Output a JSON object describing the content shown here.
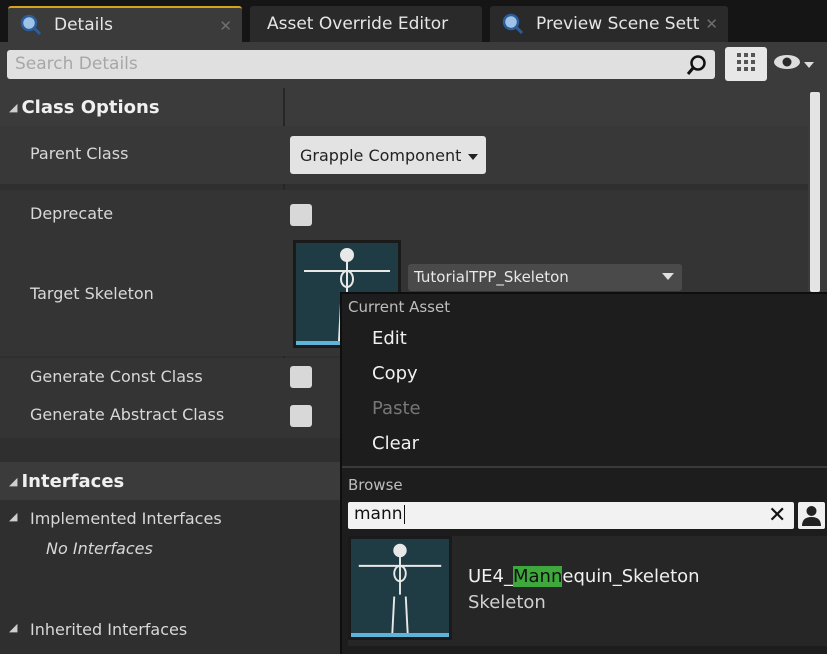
{
  "tabs": [
    {
      "label": "Details",
      "close": "✕",
      "icon": "search-icon"
    },
    {
      "label": "Asset Override Editor"
    },
    {
      "label": "Preview Scene Sett",
      "close": "✕",
      "icon": "search-icon"
    }
  ],
  "search": {
    "placeholder": "Search Details"
  },
  "class_options": {
    "header": "Class Options",
    "parent_class_label": "Parent Class",
    "parent_class_value": "Grapple Component",
    "deprecate_label": "Deprecate",
    "target_skeleton_label": "Target Skeleton",
    "target_skeleton_value": "TutorialTPP_Skeleton",
    "generate_const_label": "Generate Const Class",
    "generate_abstract_label": "Generate Abstract Class"
  },
  "interfaces": {
    "header": "Interfaces",
    "implemented_label": "Implemented Interfaces",
    "implemented_value": "No Interfaces",
    "inherited_label": "Inherited Interfaces"
  },
  "popup": {
    "current_asset_label": "Current Asset",
    "items": [
      "Edit",
      "Copy",
      "Paste",
      "Clear"
    ],
    "browse_label": "Browse",
    "filter_value": "mann",
    "clear_glyph": "✕",
    "result_prefix": "UE4_",
    "result_highlight": "Mann",
    "result_suffix": "equin_Skeleton",
    "result_type": "Skeleton"
  },
  "colors": {
    "accent": "#d7a31c",
    "highlight": "#3ea83c",
    "thumb_bar": "#5fb2d8"
  }
}
